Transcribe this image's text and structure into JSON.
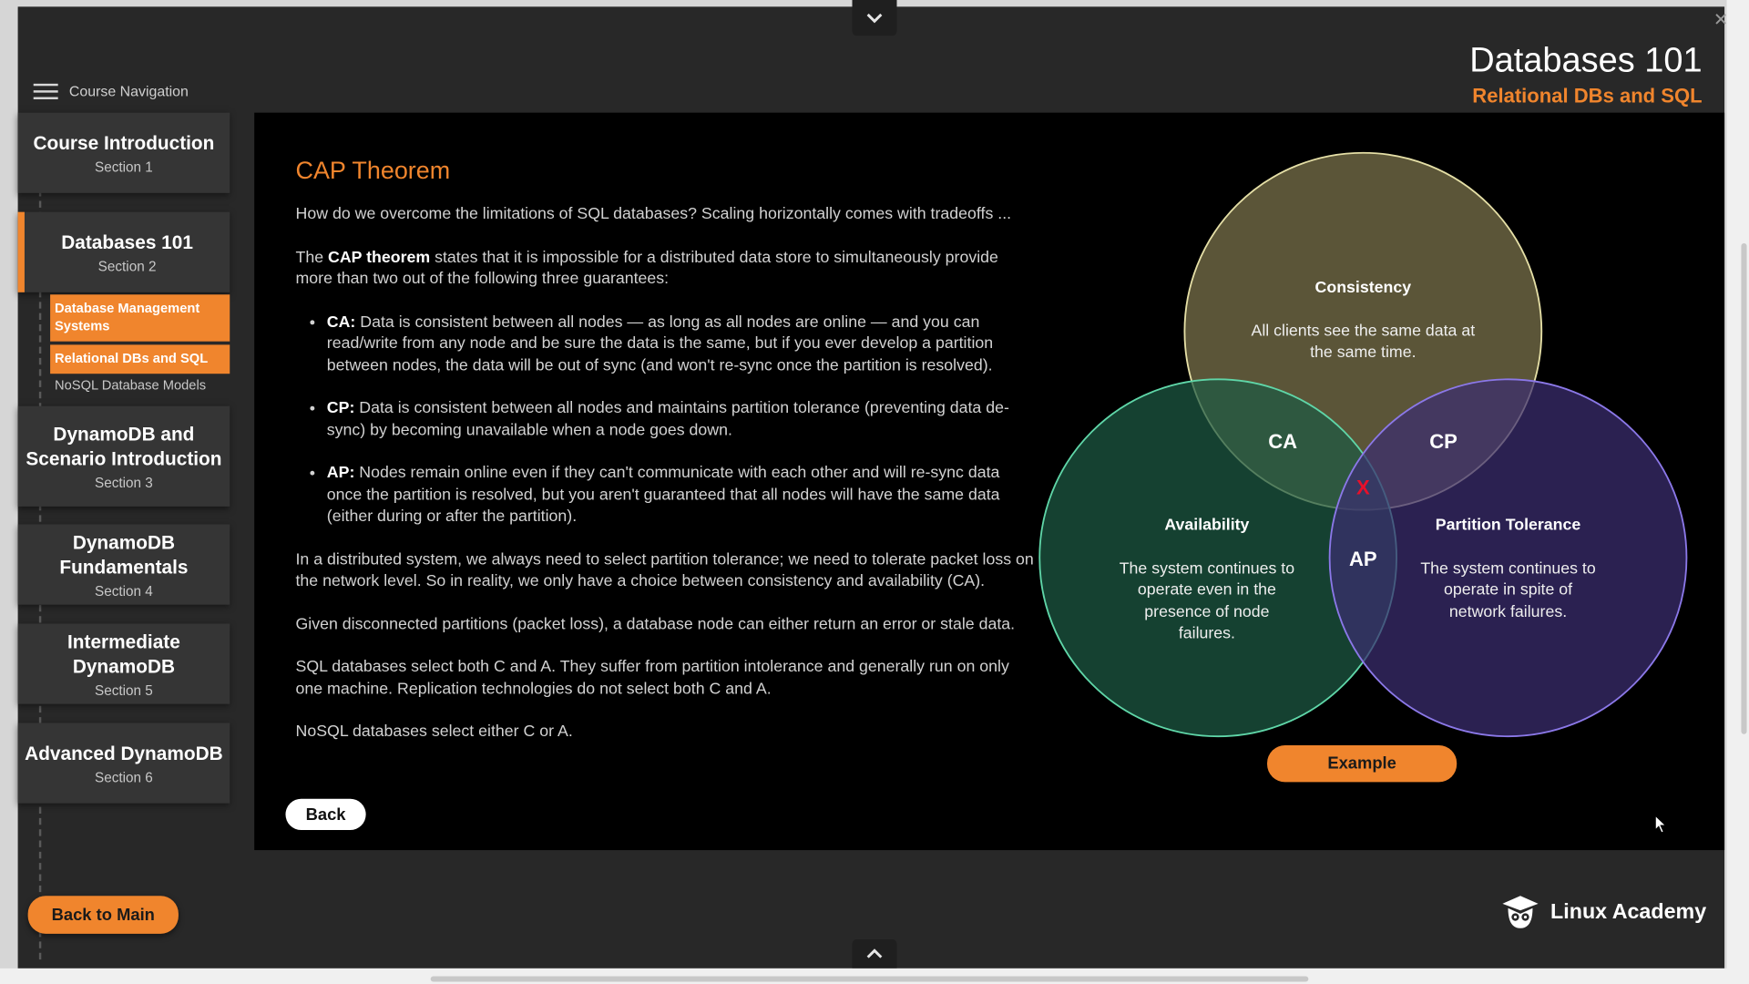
{
  "header": {
    "title": "Databases 101",
    "subtitle": "Relational DBs and SQL"
  },
  "nav": {
    "label": "Course Navigation",
    "sections": [
      {
        "title": "Course Introduction",
        "section": "Section 1"
      },
      {
        "title": "Databases 101",
        "section": "Section 2"
      },
      {
        "title": "DynamoDB and Scenario Introduction",
        "section": "Section 3"
      },
      {
        "title": "DynamoDB Fundamentals",
        "section": "Section 4"
      },
      {
        "title": "Intermediate DynamoDB",
        "section": "Section 5"
      },
      {
        "title": "Advanced DynamoDB",
        "section": "Section 6"
      }
    ],
    "subitems": [
      {
        "label": "Database Management Systems"
      },
      {
        "label": "Relational DBs and SQL"
      },
      {
        "label": "NoSQL Database Models"
      }
    ]
  },
  "content": {
    "title": "CAP Theorem",
    "intro": "How do we overcome the limitations of SQL databases? Scaling horizontally comes with tradeoffs ...",
    "p1_before": "The ",
    "p1_bold": "CAP theorem",
    "p1_after": " states that it is impossible for a distributed data store to simultaneously provide more than two out of the following three guarantees:",
    "bullets": [
      {
        "label": "CA:",
        "text": " Data is consistent between all nodes — as long as all nodes are online — and you can read/write from any node and be sure the data is the same, but if you ever develop a partition between nodes, the data will be out of sync (and won't re-sync once the partition is resolved)."
      },
      {
        "label": "CP:",
        "text": " Data is consistent between all nodes and maintains partition tolerance (preventing data de-sync) by becoming unavailable when a node goes down."
      },
      {
        "label": "AP:",
        "text": " Nodes remain online even if they can't communicate with each other and will re-sync data once the partition is resolved, but you aren't guaranteed that all nodes will have the same data (either during or after the partition)."
      }
    ],
    "p2": "In a distributed system, we always need to select partition tolerance; we need to tolerate packet loss on the network level. So in reality, we only have a choice between consistency and availability (CA).",
    "p3": "Given disconnected partitions (packet loss), a database node can either return an error or stale data.",
    "p4": "SQL databases select both C and A. They suffer from partition intolerance and generally run on only one machine. Replication technologies do not select both C and A.",
    "p5": "NoSQL databases select either C or A."
  },
  "diagram": {
    "consistency_title": "Consistency",
    "consistency_line1": "All clients see the same data at",
    "consistency_line2": "the same time.",
    "availability_title": "Availability",
    "availability_line1": "The system continues to",
    "availability_line2": "operate even in the",
    "availability_line3": "presence of node",
    "availability_line4": "failures.",
    "partition_title": "Partition Tolerance",
    "partition_line1": "The system continues to",
    "partition_line2": "operate in spite of",
    "partition_line3": "network failures.",
    "ca": "CA",
    "cp": "CP",
    "ap": "AP",
    "center": "X",
    "colors": {
      "consistency": "#6b6442",
      "availability": "#1d5a44",
      "partition": "#3b2e70",
      "accent": "#f0852d"
    }
  },
  "buttons": {
    "back": "Back",
    "example": "Example",
    "back_to_main": "Back to Main"
  },
  "brand": {
    "name": "Linux Academy"
  }
}
